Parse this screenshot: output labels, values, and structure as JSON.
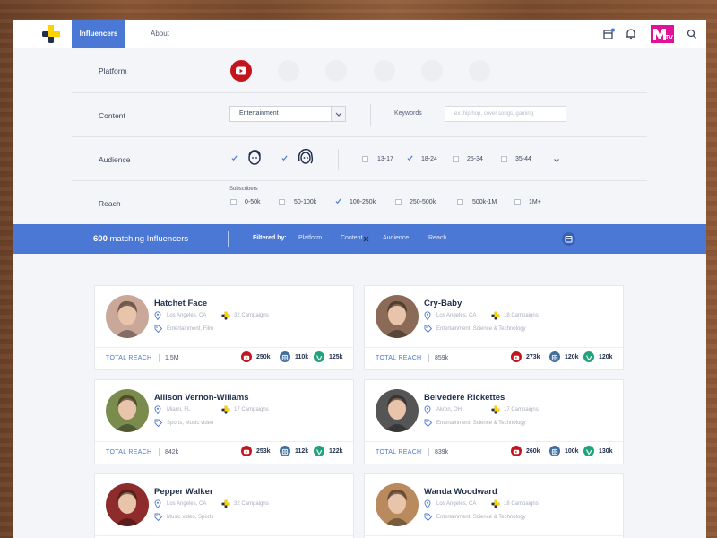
{
  "nav": {
    "tabs": [
      {
        "label": "Influencers",
        "active": true
      },
      {
        "label": "About",
        "active": false
      }
    ],
    "icons": [
      "calendar-icon",
      "bell-icon",
      "mtv-logo",
      "search-icon"
    ],
    "brand_logo_text": "MTV"
  },
  "filters": {
    "platform": {
      "label": "Platform",
      "platforms": [
        {
          "name": "youtube",
          "selected": true
        },
        {
          "name": "facebook",
          "selected": false
        },
        {
          "name": "twitter",
          "selected": false
        },
        {
          "name": "instagram",
          "selected": false
        },
        {
          "name": "vine",
          "selected": false
        },
        {
          "name": "tumblr",
          "selected": false
        }
      ]
    },
    "content": {
      "label": "Content",
      "selected": "Entertainment",
      "keywords_label": "Keywords",
      "keywords_placeholder": "ex: hip hop, cover songs, gaming"
    },
    "audience": {
      "label": "Audience",
      "gender": [
        {
          "name": "male",
          "checked": true
        },
        {
          "name": "female",
          "checked": true
        }
      ],
      "ages": [
        {
          "label": "13-17",
          "checked": false
        },
        {
          "label": "18-24",
          "checked": true
        },
        {
          "label": "25-34",
          "checked": false
        },
        {
          "label": "35-44",
          "checked": false
        }
      ]
    },
    "reach": {
      "label": "Reach",
      "sublabel": "Subscribers",
      "options": [
        {
          "label": "0-50k",
          "checked": false
        },
        {
          "label": "50-100k",
          "checked": false
        },
        {
          "label": "100-250k",
          "checked": true
        },
        {
          "label": "250-500k",
          "checked": false
        },
        {
          "label": "500k-1M",
          "checked": false
        },
        {
          "label": "1M+",
          "checked": false
        }
      ]
    }
  },
  "summary": {
    "count": "600",
    "count_suffix": "matching Influencers",
    "filtered_by": "Filtered by:",
    "chips": [
      "Platform",
      "Content",
      "Audience",
      "Reach"
    ]
  },
  "influencers": [
    {
      "name": "Hatchet Face",
      "location": "Los Angeles, CA",
      "campaigns": "32 Campaigns",
      "tags": "Entertainment, Film",
      "total_reach_label": "TOTAL REACH",
      "total_reach": "1.5M",
      "youtube": "250k",
      "instagram": "110k",
      "vine": "125k",
      "photo_color": "#c9a89a"
    },
    {
      "name": "Cry-Baby",
      "location": "Los Angeles, CA",
      "campaigns": "18 Campaigns",
      "tags": "Entertainment, Science & Technology",
      "total_reach_label": "TOTAL REACH",
      "total_reach": "859k",
      "youtube": "273k",
      "instagram": "120k",
      "vine": "120k",
      "photo_color": "#8b6a58"
    },
    {
      "name": "Allison Vernon-Willams",
      "location": "Miami, FL",
      "campaigns": "17 Campaigns",
      "tags": "Sports, Music video",
      "total_reach_label": "TOTAL REACH",
      "total_reach": "842k",
      "youtube": "253k",
      "instagram": "112k",
      "vine": "122k",
      "photo_color": "#7a8b4e"
    },
    {
      "name": "Belvedere Rickettes",
      "location": "Akron, OH",
      "campaigns": "17 Campaigns",
      "tags": "Entertainment, Science & Technology",
      "total_reach_label": "TOTAL REACH",
      "total_reach": "839k",
      "youtube": "260k",
      "instagram": "100k",
      "vine": "130k",
      "photo_color": "#555555"
    },
    {
      "name": "Pepper Walker",
      "location": "Los Angeles, CA",
      "campaigns": "32 Campaigns",
      "tags": "Music video, Sports",
      "total_reach_label": "",
      "total_reach": "",
      "youtube": "",
      "instagram": "",
      "vine": "",
      "photo_color": "#8e2b2b"
    },
    {
      "name": "Wanda Woodward",
      "location": "Los Angeles, CA",
      "campaigns": "18 Campaigns",
      "tags": "Entertainment, Science & Technology",
      "total_reach_label": "",
      "total_reach": "",
      "youtube": "",
      "instagram": "",
      "vine": "",
      "photo_color": "#b98a5e"
    }
  ],
  "colors": {
    "accent": "#4a78d4",
    "youtube": "#c4151c",
    "instagram": "#3f6e9c",
    "vine": "#1fa37d",
    "mtv": "#e0129a",
    "brand_yellow": "#ffd100",
    "brand_navy": "#22304d"
  }
}
